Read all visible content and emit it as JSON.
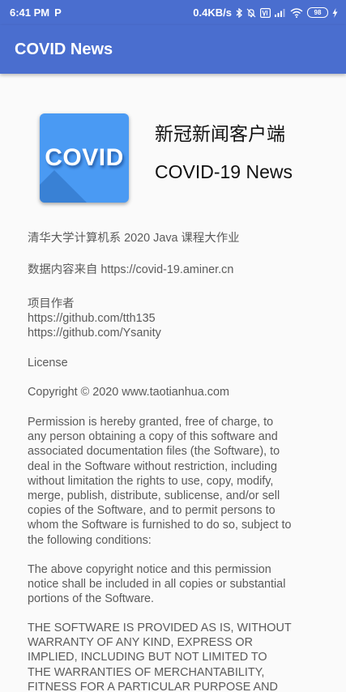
{
  "status_bar": {
    "time": "6:41 PM",
    "carrier_icon": "P",
    "speed": "0.4KB/s",
    "battery": "98"
  },
  "app_bar": {
    "title": "COVID News"
  },
  "logo": {
    "text": "COVID",
    "background": "#4a9af3"
  },
  "app_name_cn": "新冠新闻客户端",
  "app_name_en": "COVID-19 News",
  "course": "清华大学计算机系 2020 Java 课程大作业",
  "data_source": "数据内容来自 https://covid-19.aminer.cn",
  "authors": {
    "label": "项目作者",
    "links": [
      "https://github.com/tth135",
      "https://github.com/Ysanity"
    ]
  },
  "license": {
    "heading": "License",
    "copyright": "Copyright © 2020 www.taotianhua.com",
    "permission_lines": [
      "Permission is hereby granted, free of charge, to",
      "any person obtaining a copy of this software and",
      "associated documentation files (the Software), to",
      "deal in the Software without restriction, including",
      "without limitation the rights to use, copy, modify,",
      "merge, publish, distribute, sublicense, and/or sell",
      "copies of the Software, and to permit persons to",
      "whom the Software is furnished to do so, subject to",
      "the following conditions:"
    ],
    "notice_lines": [
      "The above copyright notice and this permission",
      "notice shall be included in all copies or substantial",
      "portions of the Software."
    ],
    "warranty_lines": [
      "THE SOFTWARE IS PROVIDED AS IS, WITHOUT",
      "WARRANTY OF ANY KIND, EXPRESS OR",
      "IMPLIED, INCLUDING BUT NOT LIMITED TO",
      "THE WARRANTIES OF MERCHANTABILITY,",
      "FITNESS FOR A PARTICULAR PURPOSE AND"
    ]
  },
  "colors": {
    "primary": "#4a6ecf",
    "background": "#fafafa",
    "body_text": "#5b5b5b"
  }
}
